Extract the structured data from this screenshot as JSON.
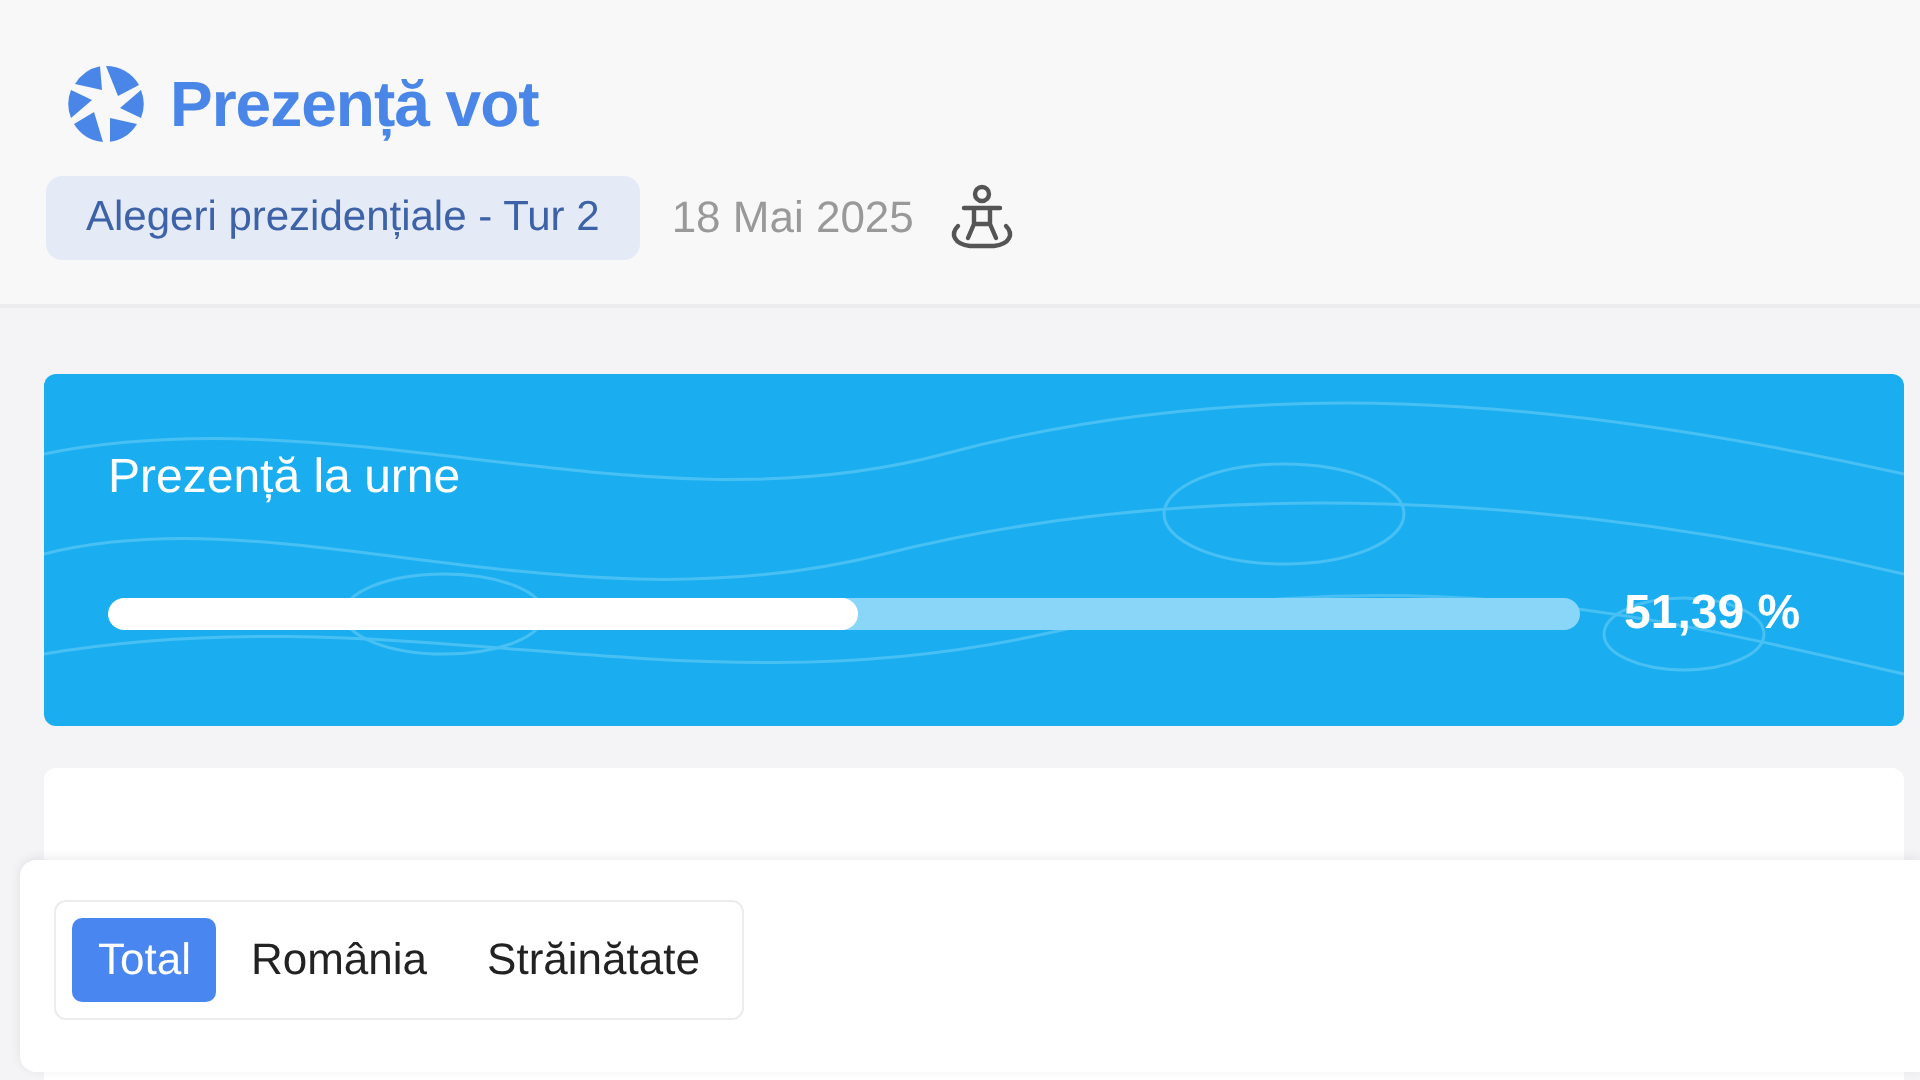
{
  "header": {
    "title": "Prezență vot",
    "election": "Alegeri prezidențiale - Tur 2",
    "date": "18 Mai 2025"
  },
  "turnout": {
    "title": "Prezență la urne",
    "level": 0.51,
    "reading": "51,39 %"
  },
  "tabs": [
    {
      "label": "Total",
      "selected": true
    },
    {
      "label": "România",
      "selected": false
    },
    {
      "label": "Străinătate",
      "selected": false
    }
  ]
}
